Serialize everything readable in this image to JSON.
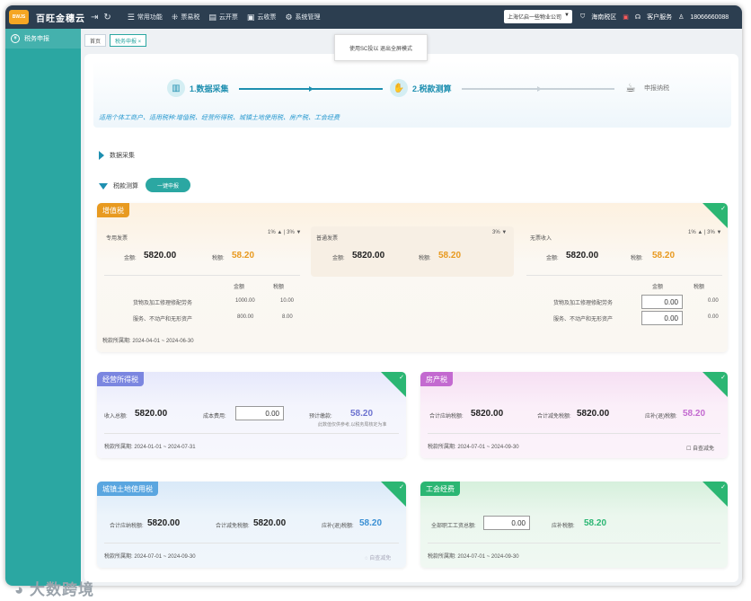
{
  "topbar": {
    "brand": "百旺金穗云",
    "menu": [
      {
        "icon": "grid-icon",
        "label": "常用功能"
      },
      {
        "icon": "ticket-icon",
        "label": "票易税"
      },
      {
        "icon": "invoice-icon",
        "label": "云开票"
      },
      {
        "icon": "receive-icon",
        "label": "云收票"
      },
      {
        "icon": "gear-icon",
        "label": "系统管理"
      }
    ],
    "company": "上海亿启一些物业公司",
    "right": [
      "海南税区",
      "客户服务",
      "18066660088"
    ]
  },
  "sidebar": {
    "items": [
      {
        "label": "税务申报"
      }
    ]
  },
  "tabs": [
    {
      "label": "首页"
    },
    {
      "label": "税务申报 ×"
    }
  ],
  "tooltip": "使用SC投以 退出全屏模式",
  "steps": [
    {
      "label": "1.数据采集"
    },
    {
      "label": "2.税款测算"
    },
    {
      "label": "申报纳税"
    }
  ],
  "scope": "适用个体工商户、适用税种:增值税、经营所得税、城镇土地使用税、房产税、工会经费",
  "sections": {
    "collect": "数据采集",
    "calc": "税款测算",
    "declare_btn": "一键申报"
  },
  "vat": {
    "badge": "增值税",
    "special": {
      "title": "专用发票",
      "rate": "1% ▲ | 3% ▼",
      "amount_label": "金额:",
      "amount": "5820.00",
      "tax_label": "税额:",
      "tax": "58.20"
    },
    "general": {
      "title": "普通发票",
      "rate": "3% ▼",
      "amount_label": "金额:",
      "amount": "5820.00",
      "tax_label": "税额:",
      "tax": "58.20"
    },
    "noinvoice": {
      "title": "无票收入",
      "rate": "1% ▲ | 3% ▼",
      "amount_label": "金额:",
      "amount": "5820.00",
      "tax_label": "税额:",
      "tax": "58.20"
    },
    "detail_headers": [
      "金额",
      "税额"
    ],
    "special_rows": [
      {
        "name": "货物及加工修理修配劳务",
        "amount": "1000.00",
        "tax": "10.00"
      },
      {
        "name": "服务、不动产和无形资产",
        "amount": "800.00",
        "tax": "8.00"
      }
    ],
    "noinvoice_rows": [
      {
        "name": "货物及加工修理修配劳务",
        "amount": "0.00",
        "tax": "0.00"
      },
      {
        "name": "服务、不动产和无形资产",
        "amount": "0.00",
        "tax": "0.00"
      }
    ],
    "period": "税款所属期: 2024-04-01 ~ 2024-06-30"
  },
  "biz": {
    "badge": "经营所得税",
    "income_label": "收入总额:",
    "income": "5820.00",
    "cost_label": "成本费用:",
    "cost": "0.00",
    "est_label": "预计缴款:",
    "est": "58.20",
    "note": "此数值仅供参考,以税务局核定为准",
    "period": "税款所属期: 2024-01-01 ~ 2024-07-31"
  },
  "property": {
    "badge": "房产税",
    "total_label": "合计应纳税额:",
    "total": "5820.00",
    "reduce_label": "合计减免税额:",
    "reduce": "5820.00",
    "pay_label": "应补(退)税额:",
    "pay": "58.20",
    "period": "税款所属期: 2024-07-01 ~ 2024-09-30",
    "check": "自查减免"
  },
  "land": {
    "badge": "城镇土地使用税",
    "total_label": "合计应纳税额:",
    "total": "5820.00",
    "reduce_label": "合计减免税额:",
    "reduce": "5820.00",
    "pay_label": "应补(退)税额:",
    "pay": "58.20",
    "period": "税款所属期: 2024-07-01 ~ 2024-09-30",
    "check": "自查减免"
  },
  "union": {
    "badge": "工会经费",
    "wage_label": "全部职工工资总额:",
    "wage": "0.00",
    "pay_label": "应补税额:",
    "pay": "58.20",
    "period": "税款所属期: 2024-07-01 ~ 2024-09-30"
  },
  "watermark": "大数跨境",
  "colors": {
    "teal": "#2ba7a2",
    "orange": "#e89a20",
    "green": "#2bb673",
    "purple": "#c36ad0"
  }
}
